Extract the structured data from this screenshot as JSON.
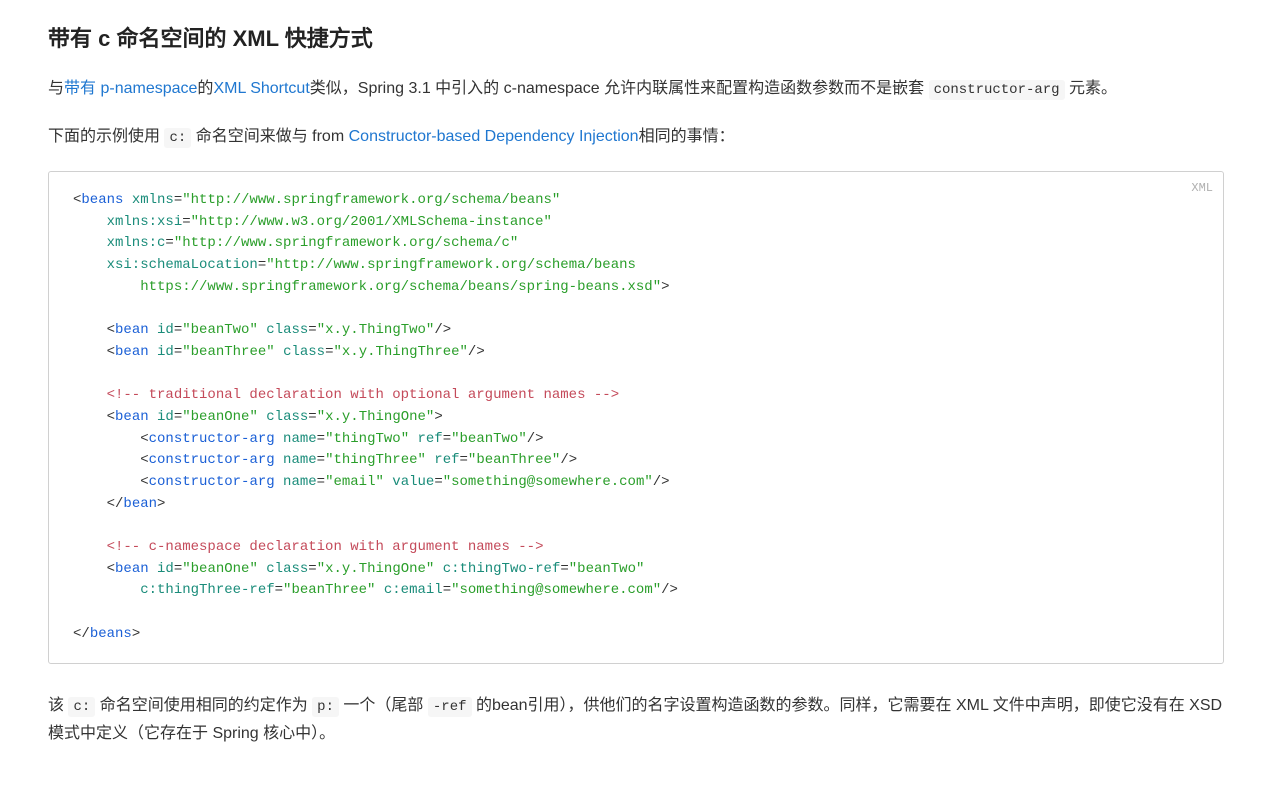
{
  "heading": "带有 c 命名空间的 XML 快捷方式",
  "p1": {
    "t1": "与",
    "link1": "带有 p-namespace",
    "t2": "的",
    "link2": "XML Shortcut",
    "t3": "类似，Spring 3.1 中引入的 c-namespace 允许内联属性来配置构造函数参数而不是嵌套",
    "code1": "constructor-arg",
    "t4": " 元素。"
  },
  "p2": {
    "t1": "下面的示例使用 ",
    "code1": "c:",
    "t2": " 命名空间来做与 from ",
    "link1": "Constructor-based Dependency Injection",
    "t3": "相同的事情："
  },
  "codeLang": "XML",
  "code": {
    "l01a": "<",
    "l01b": "beans",
    "l01c": " xmlns",
    "l01d": "=",
    "l01e": "\"http://www.springframework.org/schema/beans\"",
    "l02a": "    xmlns:xsi",
    "l02b": "=",
    "l02c": "\"http://www.w3.org/2001/XMLSchema-instance\"",
    "l03a": "    xmlns:c",
    "l03b": "=",
    "l03c": "\"http://www.springframework.org/schema/c\"",
    "l04a": "    xsi:schemaLocation",
    "l04b": "=",
    "l04c": "\"http://www.springframework.org/schema/beans",
    "l05a": "        https://www.springframework.org/schema/beans/spring-beans.xsd\"",
    "l05b": ">",
    "l07a": "    <",
    "l07b": "bean",
    "l07c": " id",
    "l07d": "=",
    "l07e": "\"beanTwo\"",
    "l07f": " class",
    "l07g": "=",
    "l07h": "\"x.y.ThingTwo\"",
    "l07i": "/>",
    "l08a": "    <",
    "l08b": "bean",
    "l08c": " id",
    "l08d": "=",
    "l08e": "\"beanThree\"",
    "l08f": " class",
    "l08g": "=",
    "l08h": "\"x.y.ThingThree\"",
    "l08i": "/>",
    "l10a": "    <!-- traditional declaration with optional argument names -->",
    "l11a": "    <",
    "l11b": "bean",
    "l11c": " id",
    "l11d": "=",
    "l11e": "\"beanOne\"",
    "l11f": " class",
    "l11g": "=",
    "l11h": "\"x.y.ThingOne\"",
    "l11i": ">",
    "l12a": "        <",
    "l12b": "constructor-arg",
    "l12c": " name",
    "l12d": "=",
    "l12e": "\"thingTwo\"",
    "l12f": " ref",
    "l12g": "=",
    "l12h": "\"beanTwo\"",
    "l12i": "/>",
    "l13a": "        <",
    "l13b": "constructor-arg",
    "l13c": " name",
    "l13d": "=",
    "l13e": "\"thingThree\"",
    "l13f": " ref",
    "l13g": "=",
    "l13h": "\"beanThree\"",
    "l13i": "/>",
    "l14a": "        <",
    "l14b": "constructor-arg",
    "l14c": " name",
    "l14d": "=",
    "l14e": "\"email\"",
    "l14f": " value",
    "l14g": "=",
    "l14h": "\"something@somewhere.com\"",
    "l14i": "/>",
    "l15a": "    </",
    "l15b": "bean",
    "l15c": ">",
    "l17a": "    <!-- c-namespace declaration with argument names -->",
    "l18a": "    <",
    "l18b": "bean",
    "l18c": " id",
    "l18d": "=",
    "l18e": "\"beanOne\"",
    "l18f": " class",
    "l18g": "=",
    "l18h": "\"x.y.ThingOne\"",
    "l18i": " c:thingTwo-ref",
    "l18j": "=",
    "l18k": "\"beanTwo\"",
    "l19a": "        c:thingThree-ref",
    "l19b": "=",
    "l19c": "\"beanThree\"",
    "l19d": " c:email",
    "l19e": "=",
    "l19f": "\"something@somewhere.com\"",
    "l19g": "/>",
    "l21a": "</",
    "l21b": "beans",
    "l21c": ">"
  },
  "p3": {
    "t1": "该 ",
    "code1": "c:",
    "t2": " 命名空间使用相同的约定作为 ",
    "code2": "p:",
    "t3": " 一个（尾部 ",
    "code3": "-ref",
    "t4": " 的bean引用），供他们的名字设置构造函数的参数。同样，它需要在 XML 文件中声明，即使它没有在 XSD 模式中定义（它存在于 Spring 核心中）。"
  }
}
